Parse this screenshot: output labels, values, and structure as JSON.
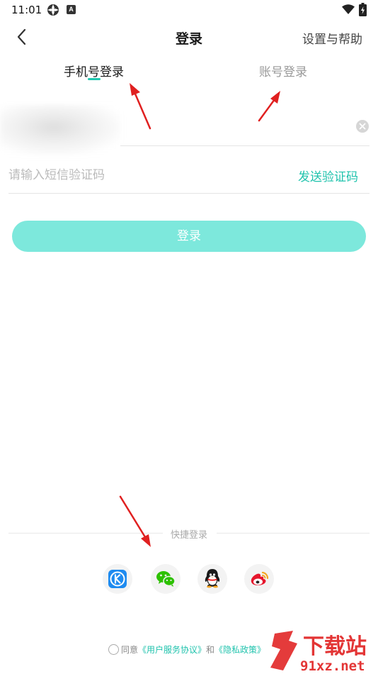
{
  "status_bar": {
    "time": "11:01",
    "badge_letter": "A"
  },
  "header": {
    "title": "登录",
    "help_label": "设置与帮助"
  },
  "tabs": [
    {
      "label": "手机号登录",
      "active": true
    },
    {
      "label": "账号登录",
      "active": false
    }
  ],
  "form": {
    "code_placeholder": "请输入短信验证码",
    "send_code_label": "发送验证码",
    "login_label": "登录"
  },
  "quick_login": {
    "label": "快捷登录",
    "providers": [
      "kugou",
      "wechat",
      "qq",
      "weibo"
    ]
  },
  "agreement": {
    "prefix": "同意",
    "service_link": "《用户服务协议》",
    "conjunction": "和",
    "privacy_link": "《隐私政策》"
  },
  "watermark": {
    "text_top": "下载站",
    "text_bottom": "91xz.net"
  },
  "colors": {
    "accent": "#20c3ad",
    "login_button": "#7de8dc",
    "annotation_arrow": "#e02020"
  }
}
